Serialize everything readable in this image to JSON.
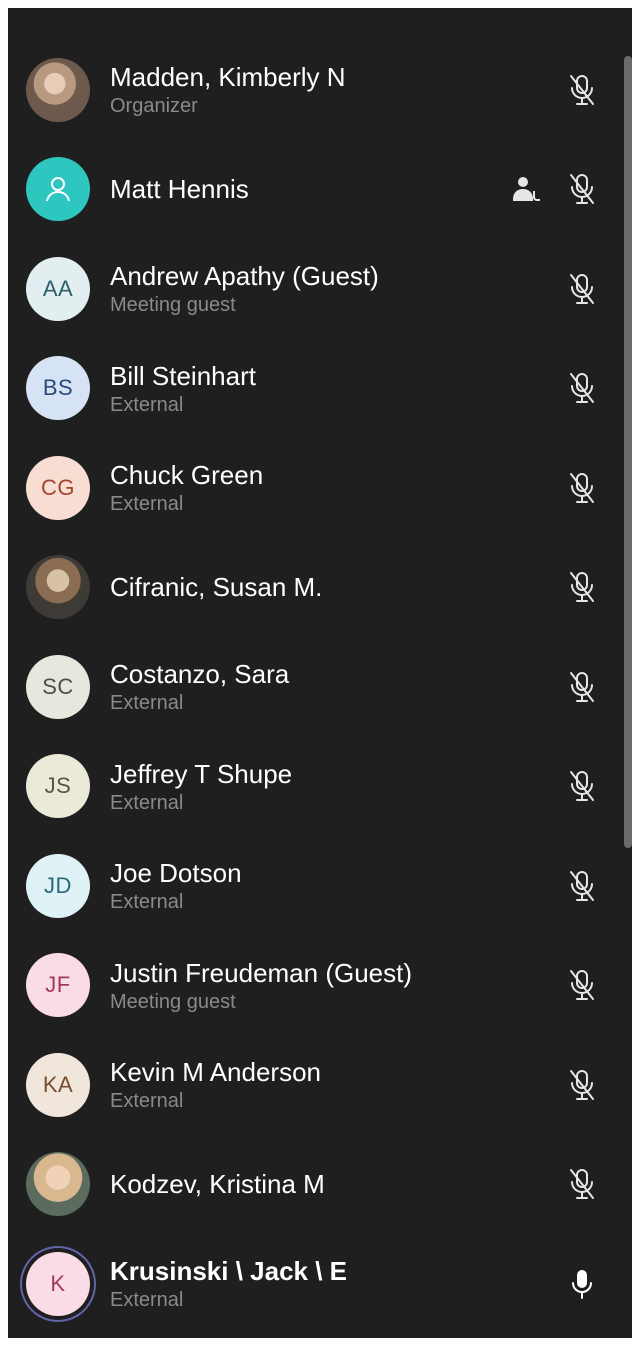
{
  "participants": [
    {
      "name": "Madden, Kimberly N",
      "sub": "Organizer",
      "avatar_type": "photo",
      "initials": "",
      "avatar_bg": "",
      "avatar_fg": "",
      "mic": "mic-off-icon",
      "presenter": false,
      "bold": false
    },
    {
      "name": "Matt Hennis",
      "sub": "",
      "avatar_type": "default-person-icon",
      "initials": "",
      "avatar_bg": "#2ec7c0",
      "avatar_fg": "#ffffff",
      "mic": "mic-off-icon",
      "presenter": true,
      "bold": false
    },
    {
      "name": "Andrew Apathy (Guest)",
      "sub": "Meeting guest",
      "avatar_type": "initials",
      "initials": "AA",
      "avatar_bg": "#e3eef0",
      "avatar_fg": "#2b5f6b",
      "mic": "mic-off-icon",
      "presenter": false,
      "bold": false
    },
    {
      "name": "Bill Steinhart",
      "sub": "External",
      "avatar_type": "initials",
      "initials": "BS",
      "avatar_bg": "#d6e3f4",
      "avatar_fg": "#2a4b7a",
      "mic": "mic-off-icon",
      "presenter": false,
      "bold": false
    },
    {
      "name": "Chuck Green",
      "sub": "External",
      "avatar_type": "initials",
      "initials": "CG",
      "avatar_bg": "#f7ddd2",
      "avatar_fg": "#a3452c",
      "mic": "mic-off-icon",
      "presenter": false,
      "bold": false
    },
    {
      "name": "Cifranic, Susan M.",
      "sub": "",
      "avatar_type": "photo",
      "initials": "",
      "avatar_bg": "",
      "avatar_fg": "",
      "mic": "mic-off-icon",
      "presenter": false,
      "bold": false
    },
    {
      "name": "Costanzo, Sara",
      "sub": "External",
      "avatar_type": "initials",
      "initials": "SC",
      "avatar_bg": "#e8e7de",
      "avatar_fg": "#4d4d44",
      "mic": "mic-off-icon",
      "presenter": false,
      "bold": false
    },
    {
      "name": "Jeffrey T Shupe",
      "sub": "External",
      "avatar_type": "initials",
      "initials": "JS",
      "avatar_bg": "#ebe9d8",
      "avatar_fg": "#5a5740",
      "mic": "mic-off-icon",
      "presenter": false,
      "bold": false
    },
    {
      "name": "Joe Dotson",
      "sub": "External",
      "avatar_type": "initials",
      "initials": "JD",
      "avatar_bg": "#dff2f6",
      "avatar_fg": "#2a6b78",
      "mic": "mic-off-icon",
      "presenter": false,
      "bold": false
    },
    {
      "name": "Justin Freudeman (Guest)",
      "sub": "Meeting guest",
      "avatar_type": "initials",
      "initials": "JF",
      "avatar_bg": "#f9dce6",
      "avatar_fg": "#a33a5e",
      "mic": "mic-off-icon",
      "presenter": false,
      "bold": false
    },
    {
      "name": "Kevin M Anderson",
      "sub": "External",
      "avatar_type": "initials",
      "initials": "KA",
      "avatar_bg": "#f1e6dc",
      "avatar_fg": "#7a4e2d",
      "mic": "mic-off-icon",
      "presenter": false,
      "bold": false
    },
    {
      "name": "Kodzev, Kristina M",
      "sub": "",
      "avatar_type": "photo",
      "initials": "",
      "avatar_bg": "",
      "avatar_fg": "",
      "mic": "mic-off-icon",
      "presenter": false,
      "bold": false
    },
    {
      "name": "Krusinski \\ Jack \\ E",
      "sub": "External",
      "avatar_type": "initials",
      "initials": "K",
      "avatar_bg": "#f9dce6",
      "avatar_fg": "#a33a5e",
      "mic": "mic-on-icon",
      "presenter": false,
      "bold": true
    }
  ]
}
